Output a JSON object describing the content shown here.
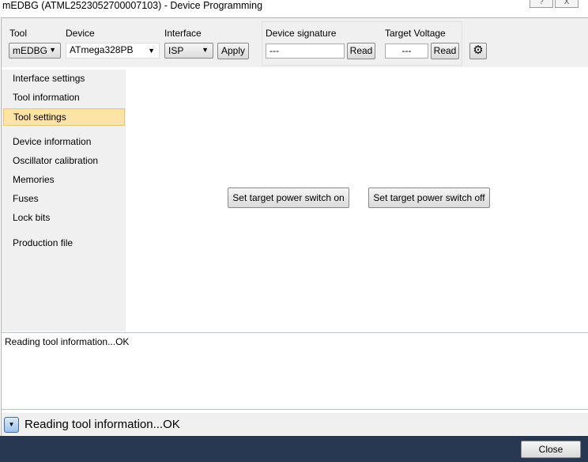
{
  "window": {
    "title": "mEDBG (ATML2523052700007103) - Device Programming",
    "help": "?",
    "close": "X"
  },
  "toolbar": {
    "tool_label": "Tool",
    "tool_value": "mEDBG",
    "device_label": "Device",
    "device_value": "ATmega328PB",
    "interface_label": "Interface",
    "interface_value": "ISP",
    "apply": "Apply",
    "signature_label": "Device signature",
    "signature_value": "---",
    "read": "Read",
    "voltage_label": "Target Voltage",
    "voltage_value": "---",
    "read2": "Read",
    "settings_icon": "gear-icon"
  },
  "sidebar": {
    "items": [
      {
        "label": "Interface settings"
      },
      {
        "label": "Tool information"
      },
      {
        "label": "Tool settings",
        "selected": true
      },
      {
        "label": "Device information"
      },
      {
        "label": "Oscillator calibration"
      },
      {
        "label": "Memories"
      },
      {
        "label": "Fuses"
      },
      {
        "label": "Lock bits"
      },
      {
        "label": "Production file"
      }
    ]
  },
  "main": {
    "power_on": "Set target power switch on",
    "power_off": "Set target power switch off"
  },
  "log": {
    "text": "Reading tool information...OK"
  },
  "status": {
    "text": "Reading tool information...OK"
  },
  "footer": {
    "close": "Close"
  }
}
